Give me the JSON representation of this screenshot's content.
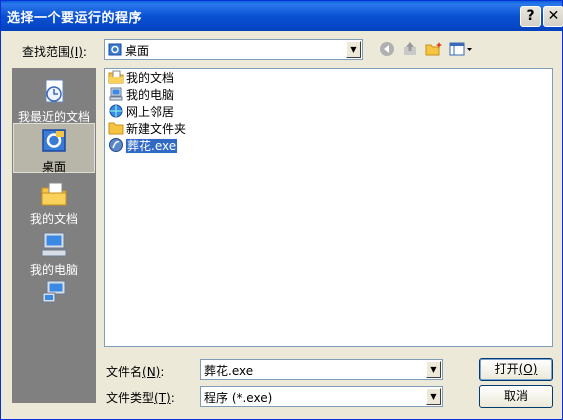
{
  "window": {
    "title": "选择一个要运行的程序",
    "help_label": "?",
    "close_label": "✕"
  },
  "lookin": {
    "label": "查找范围",
    "hotkey": "(I)",
    "colon": ":",
    "value": "桌面"
  },
  "toolbar": {
    "icons": [
      "back-icon",
      "up-folder-icon",
      "new-folder-icon",
      "view-menu-icon"
    ]
  },
  "places": [
    {
      "label": "我最近的文档",
      "icon": "recent-documents-icon"
    },
    {
      "label": "桌面",
      "icon": "desktop-icon"
    },
    {
      "label": "我的文档",
      "icon": "my-documents-icon"
    },
    {
      "label": "我的电脑",
      "icon": "my-computer-icon"
    },
    {
      "label": "",
      "icon": "network-places-icon"
    }
  ],
  "files": [
    {
      "name": "我的文档",
      "icon": "my-documents-icon"
    },
    {
      "name": "我的电脑",
      "icon": "my-computer-icon"
    },
    {
      "name": "网上邻居",
      "icon": "network-places-icon"
    },
    {
      "name": "新建文件夹",
      "icon": "folder-icon"
    },
    {
      "name": "葬花.exe",
      "icon": "exe-icon",
      "selected": true
    }
  ],
  "filename": {
    "label": "文件名",
    "hotkey": "(N)",
    "colon": ":",
    "value": "葬花.exe"
  },
  "filetype": {
    "label": "文件类型",
    "hotkey": "(T)",
    "colon": ":",
    "value": "程序 (*.exe)"
  },
  "buttons": {
    "open": "打开",
    "open_hotkey": "(O)",
    "cancel": "取消"
  },
  "colors": {
    "titlebar": "#0a52d3",
    "selection": "#316ac5",
    "places_bg": "#808080",
    "dialog_bg": "#ece9d8"
  }
}
